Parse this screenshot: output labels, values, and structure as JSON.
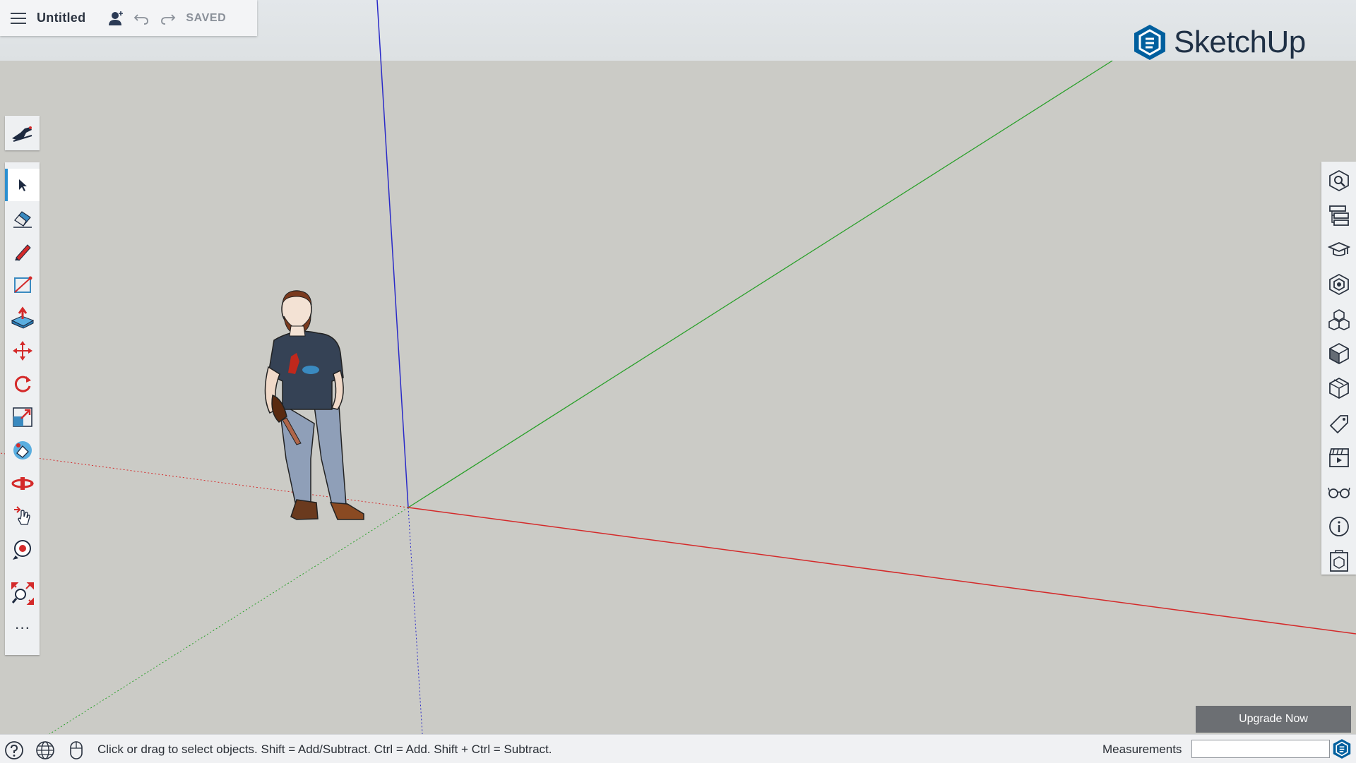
{
  "app": {
    "doc_title": "Untitled",
    "save_status": "SAVED",
    "brand": "SketchUp",
    "brand_color": "#005f9e"
  },
  "titlebar": {
    "menu_icon": "hamburger-menu-icon",
    "user_icon": "add-user-icon",
    "undo_icon": "undo-icon",
    "redo_icon": "redo-icon"
  },
  "left_toolbar": {
    "instructor_icon": "instructor-icon",
    "tools": [
      {
        "name": "select",
        "icon": "select-arrow-icon",
        "active": true
      },
      {
        "name": "eraser",
        "icon": "eraser-icon"
      },
      {
        "name": "pencil",
        "icon": "pencil-icon"
      },
      {
        "name": "rectangle",
        "icon": "rectangle-icon"
      },
      {
        "name": "push-pull",
        "icon": "push-pull-icon"
      },
      {
        "name": "move",
        "icon": "move-icon"
      },
      {
        "name": "rotate",
        "icon": "rotate-icon"
      },
      {
        "name": "scale",
        "icon": "scale-icon"
      },
      {
        "name": "paint-bucket",
        "icon": "paint-bucket-icon"
      },
      {
        "name": "orbit",
        "icon": "orbit-icon"
      },
      {
        "name": "pan",
        "icon": "pan-icon"
      },
      {
        "name": "position-camera",
        "icon": "position-camera-icon"
      },
      {
        "name": "zoom-extents",
        "icon": "zoom-extents-icon"
      },
      {
        "name": "more",
        "icon": "more-icon"
      }
    ],
    "more_label": "···"
  },
  "right_tray": {
    "panels": [
      {
        "name": "search",
        "icon": "search-model-icon"
      },
      {
        "name": "outliner",
        "icon": "outliner-icon"
      },
      {
        "name": "instructor",
        "icon": "graduation-cap-icon"
      },
      {
        "name": "styles",
        "icon": "styles-icon"
      },
      {
        "name": "components",
        "icon": "components-icon"
      },
      {
        "name": "materials",
        "icon": "materials-icon"
      },
      {
        "name": "entity",
        "icon": "entity-icon"
      },
      {
        "name": "tags",
        "icon": "tag-icon"
      },
      {
        "name": "scenes",
        "icon": "scenes-icon"
      },
      {
        "name": "display",
        "icon": "glasses-icon"
      },
      {
        "name": "info",
        "icon": "info-icon"
      },
      {
        "name": "3d-warehouse",
        "icon": "warehouse-icon"
      }
    ]
  },
  "upgrade": {
    "label": "Upgrade Now"
  },
  "statusbar": {
    "help_icon": "help-icon",
    "globe_icon": "globe-icon",
    "mouse_icon": "mouse-icon",
    "status_text": "Click or drag to select objects. Shift = Add/Subtract. Ctrl = Add. Shift + Ctrl = Subtract.",
    "measurements_label": "Measurements",
    "measurements_value": ""
  },
  "axes_colors": {
    "red": "#d42a2a",
    "green": "#2aa02a",
    "blue": "#2a2ac8"
  }
}
